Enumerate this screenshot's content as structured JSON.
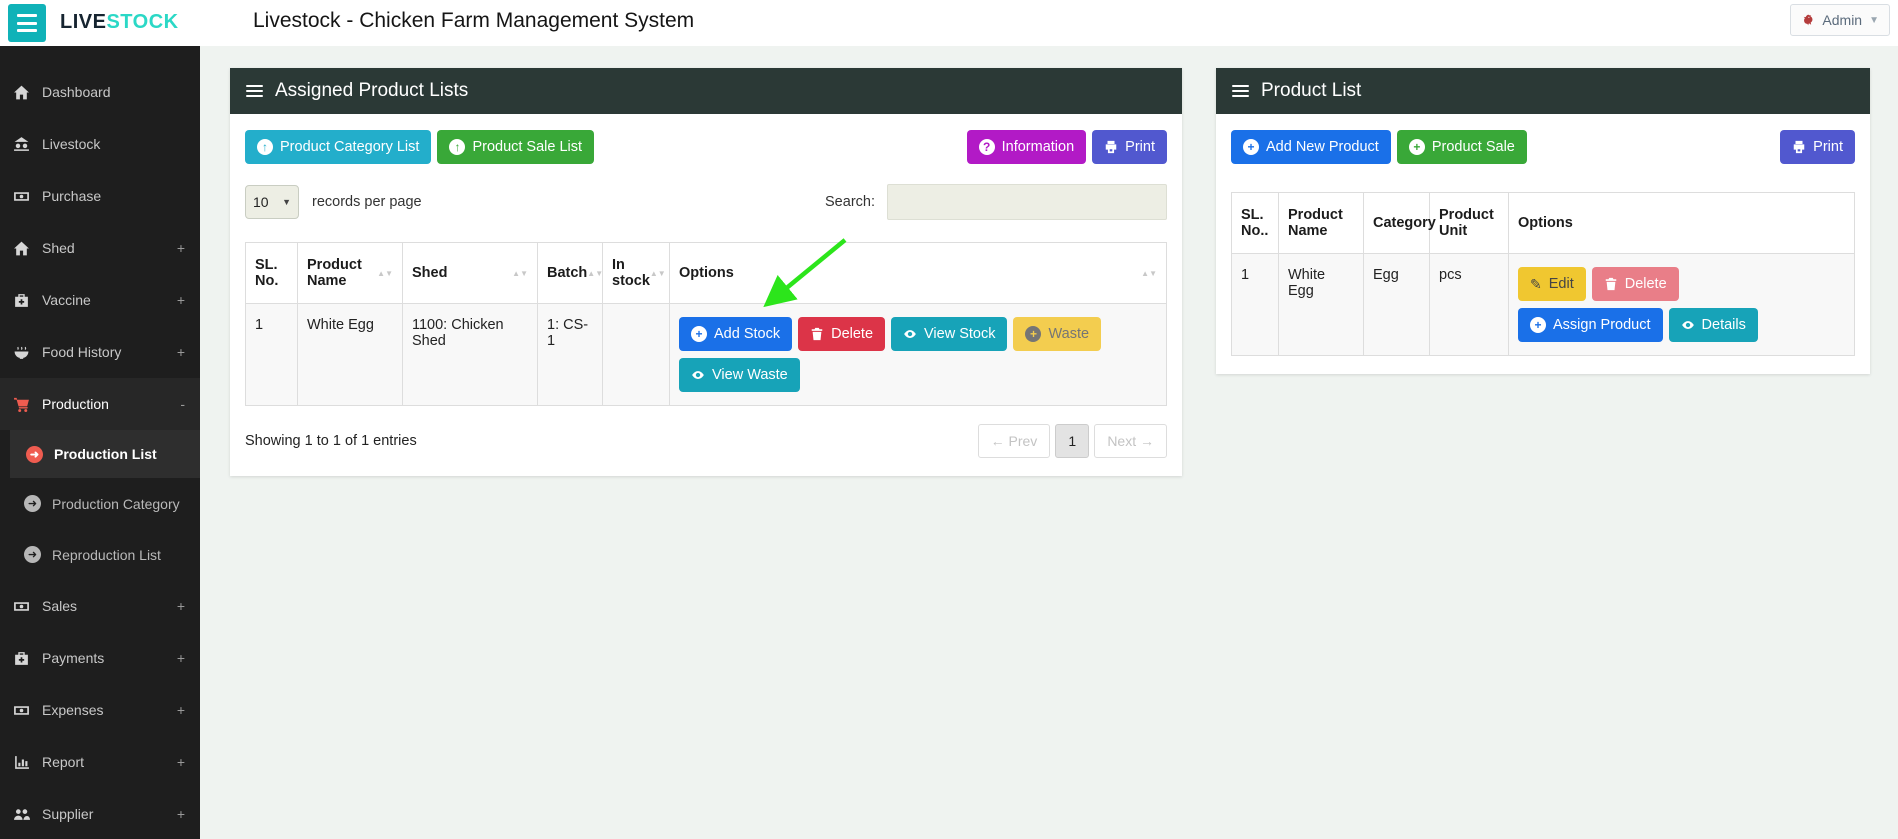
{
  "navbar": {
    "brand_live": "LIVE",
    "brand_stock": "STOCK",
    "title": "Livestock - Chicken Farm Management System",
    "admin_label": "Admin"
  },
  "sidebar": {
    "items": [
      {
        "label": "Dashboard",
        "icon": "home"
      },
      {
        "label": "Livestock",
        "icon": "livestock"
      },
      {
        "label": "Purchase",
        "icon": "banknote"
      },
      {
        "label": "Shed",
        "icon": "shed",
        "suffix": "+"
      },
      {
        "label": "Vaccine",
        "icon": "medkit",
        "suffix": "+"
      },
      {
        "label": "Food History",
        "icon": "food-bowl",
        "suffix": "+"
      },
      {
        "label": "Production",
        "icon": "cart",
        "suffix": "-"
      },
      {
        "label": "Sales",
        "icon": "banknote",
        "suffix": "+"
      },
      {
        "label": "Payments",
        "icon": "medkit",
        "suffix": "+"
      },
      {
        "label": "Expenses",
        "icon": "banknote",
        "suffix": "+"
      },
      {
        "label": "Report",
        "icon": "bar-chart",
        "suffix": "+"
      },
      {
        "label": "Supplier",
        "icon": "users",
        "suffix": "+"
      }
    ],
    "submenu": [
      {
        "label": "Production List"
      },
      {
        "label": "Production Category"
      },
      {
        "label": "Reproduction List"
      }
    ]
  },
  "assigned_panel": {
    "title": "Assigned Product Lists",
    "buttons": {
      "product_category_list": "Product Category List",
      "product_sale_list": "Product Sale List",
      "information": "Information",
      "print": "Print"
    },
    "records_per_page_value": "10",
    "records_per_page_label": "records per page",
    "search_label": "Search:",
    "table": {
      "headers": [
        "SL. No.",
        "Product Name",
        "Shed",
        "Batch",
        "In stock",
        "Options"
      ],
      "row": {
        "sl_no": "1",
        "product_name": "White Egg",
        "shed": "1100: Chicken Shed",
        "batch": "1: CS-1",
        "in_stock": "",
        "actions": [
          "Add Stock",
          "Delete",
          "View Stock",
          "Waste",
          "View Waste"
        ]
      }
    },
    "footer": {
      "showing_text": "Showing 1 to 1 of 1 entries",
      "prev_label": "← Prev",
      "page_number": "1",
      "next_label": "Next →"
    }
  },
  "product_panel": {
    "title": "Product List",
    "buttons": {
      "add_new_product": "Add New Product",
      "product_sale": "Product Sale",
      "print": "Print"
    },
    "table": {
      "headers": [
        "SL. No..",
        "Product Name",
        "Category",
        "Product Unit",
        "Options"
      ],
      "row": {
        "sl_no": "1",
        "product_name": "White Egg",
        "category": "Egg",
        "product_unit": "pcs",
        "actions": [
          "Edit",
          "Delete",
          "Assign Product",
          "Details"
        ]
      }
    }
  },
  "colors": {
    "brand_teal": "#10b2b8",
    "brand_stock_text": "#2bd8c6",
    "panel_header": "#2b3936",
    "sidebar_bg": "#1e1e1e",
    "active_accent": "#ef5c50",
    "btn_cyan": "#23aecb",
    "btn_green": "#39a838",
    "btn_magenta": "#b21ac6",
    "btn_indigo": "#5158cf",
    "btn_blue": "#1a70e8",
    "btn_red": "#dc3448",
    "btn_teal": "#17a3b8",
    "btn_yellow": "#f3cd4f",
    "btn_edit_yellow": "#f0c730",
    "btn_pink": "#e97e88",
    "annotation_green": "#2ce51b"
  }
}
